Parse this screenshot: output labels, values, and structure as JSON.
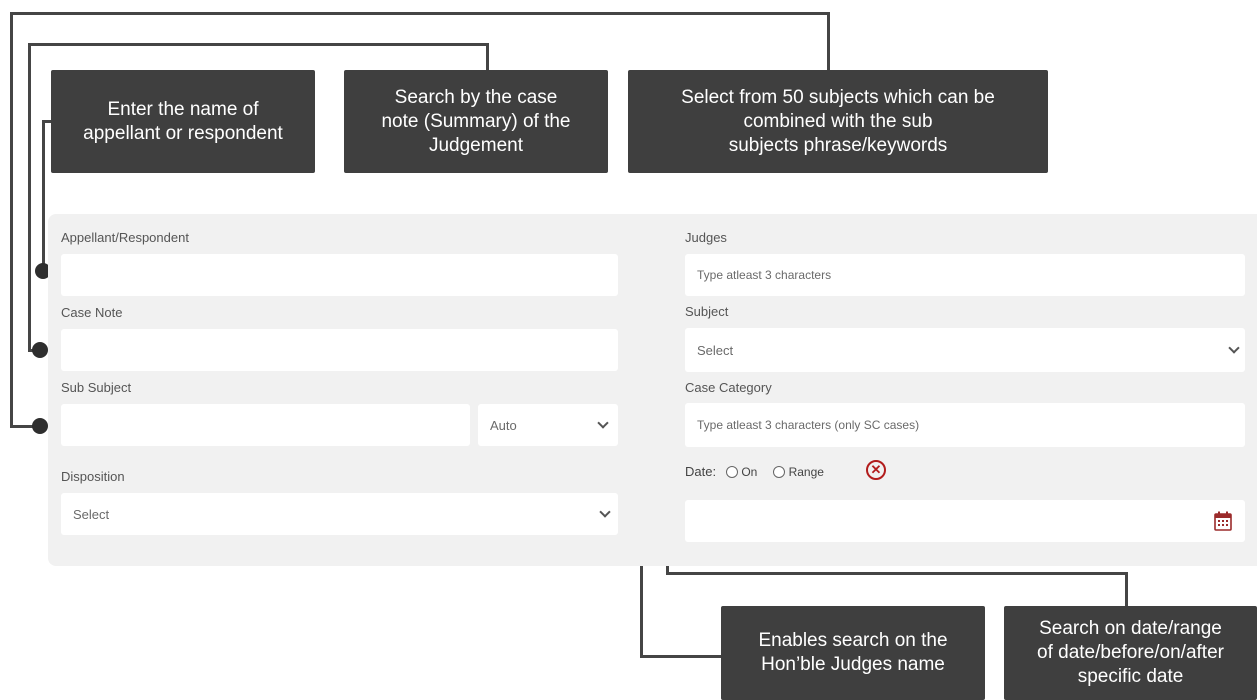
{
  "callouts": {
    "name": [
      "Enter the name of",
      "appellant or respondent"
    ],
    "case_note": [
      "Search by the case",
      "note (Summary) of the",
      "Judgement"
    ],
    "subjects": [
      "Select from 50 subjects which can be",
      "combined with the sub",
      "subjects phrase/keywords"
    ],
    "judges": [
      "Enables search on the",
      "Hon’ble Judges name"
    ],
    "date": [
      "Search on date/range",
      "of date/before/on/after",
      "specific date"
    ]
  },
  "form": {
    "appellant_label": "Appellant/Respondent",
    "appellant_value": "",
    "case_note_label": "Case Note",
    "case_note_value": "",
    "sub_subject_label": "Sub Subject",
    "sub_subject_value": "",
    "sub_subject_mode": "Auto",
    "disposition_label": "Disposition",
    "disposition_value": "Select",
    "judges_label": "Judges",
    "judges_placeholder": "Type atleast 3 characters",
    "subject_label": "Subject",
    "subject_value": "Select",
    "case_category_label": "Case Category",
    "case_category_placeholder": "Type atleast 3 characters (only SC cases)",
    "date_label": "Date:",
    "date_option_on": "On",
    "date_option_range": "Range",
    "date_value": ""
  },
  "icons": {
    "clear": "close-circle-icon",
    "calendar": "calendar-icon",
    "dropdown": "chevron-down-icon"
  },
  "colors": {
    "callout_bg": "#3f3f3f",
    "panel_bg": "#f1f1f1",
    "clear_icon": "#b21c1c",
    "calendar_icon": "#9b2b2b"
  }
}
